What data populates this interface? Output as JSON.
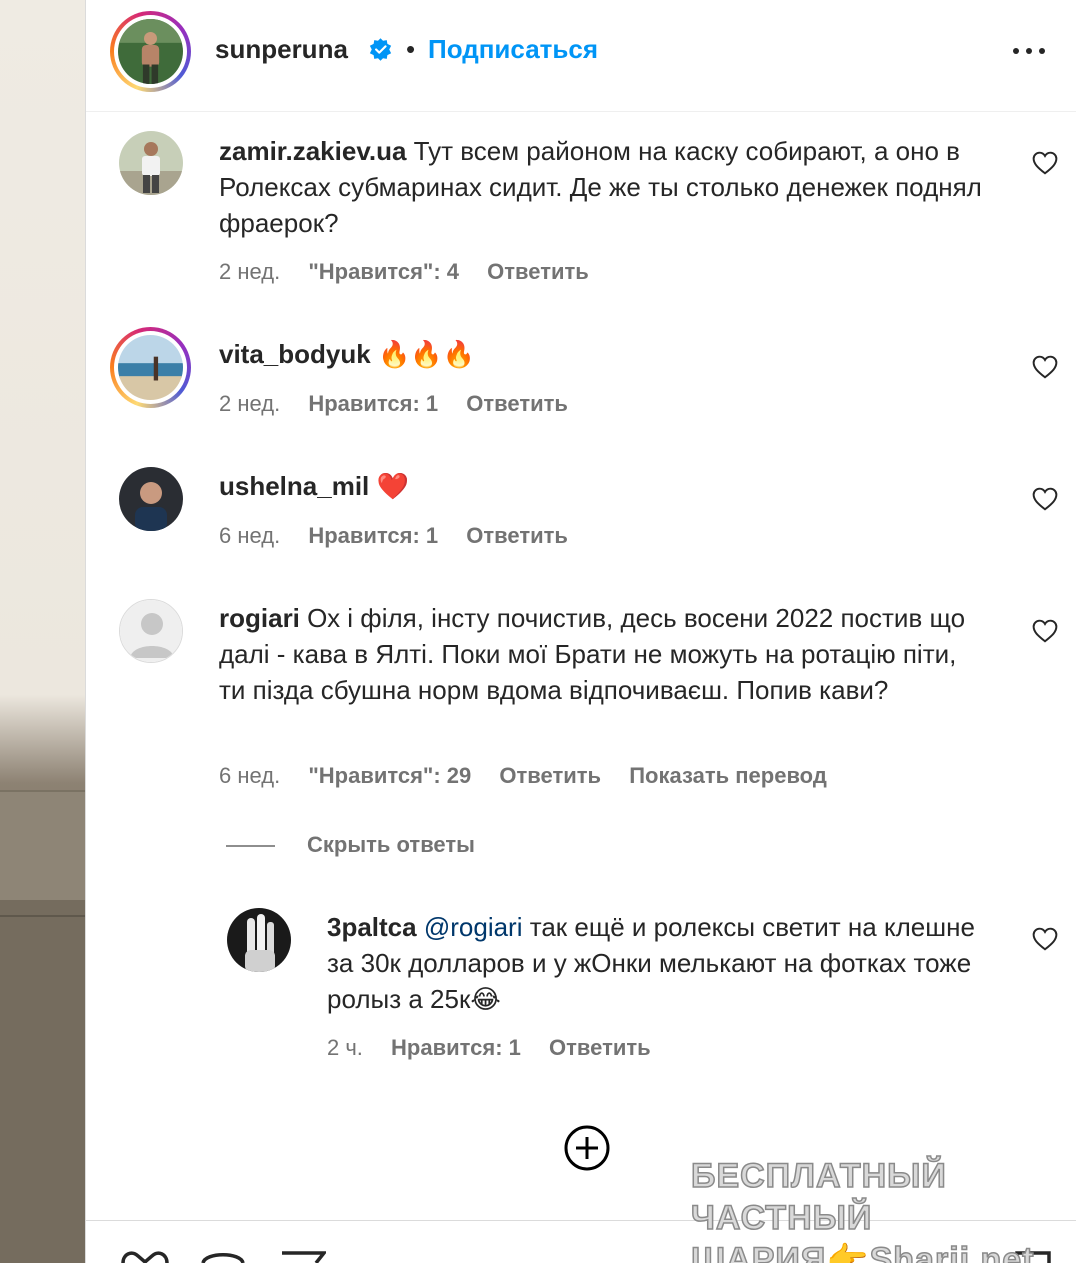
{
  "header": {
    "username": "sunperuna",
    "separator": "•",
    "follow_label": "Подписаться"
  },
  "comments": [
    {
      "username": "zamir.zakiev.ua",
      "text": "Тут всем районом на каску собирают, а оно в Ролексах субмаринах сидит. Де же ты столько денежек поднял фраерок?",
      "time": "2 нед.",
      "likes": "\"Нравится\": 4",
      "reply_label": "Ответить"
    },
    {
      "username": "vita_bodyuk",
      "text": "🔥🔥🔥",
      "time": "2 нед.",
      "likes": "Нравится: 1",
      "reply_label": "Ответить"
    },
    {
      "username": "ushelna_mil",
      "text": "❤️",
      "time": "6 нед.",
      "likes": "Нравится: 1",
      "reply_label": "Ответить"
    },
    {
      "username": "rogiari",
      "text": "Ох і філя, інсту почистив, десь восени 2022 постив що далі - кава в Ялті. Поки мої Брати не можуть на ротацію піти, ти пізда сбушна норм вдома відпочиваєш. Попив кави?",
      "time": "6 нед.",
      "likes": "\"Нравится\": 29",
      "reply_label": "Ответить",
      "translate_label": "Показать перевод"
    }
  ],
  "hide_replies_label": "Скрыть ответы",
  "reply": {
    "username": "3paltca",
    "mention": "@rogiari",
    "text": " так ещё и ролексы светит на клешне за 30к долларов и у жОнки мелькают на фотках тоже ролыз а 25к😂",
    "time": "2 ч.",
    "likes": "Нравится: 1",
    "reply_label": "Ответить"
  },
  "watermark": {
    "line1": "БЕСПЛАТНЫЙ ЧАСТНЫЙ",
    "line2": "ШАРИЯ👉Sharij.net"
  },
  "colors": {
    "accent": "#0095f6",
    "text": "#262626",
    "secondary": "#737373",
    "mention": "#00376b"
  },
  "icons": {
    "verified": "verified-badge-icon",
    "more": "more-options-icon",
    "like": "heart-icon",
    "load_more": "plus-circle-icon"
  }
}
